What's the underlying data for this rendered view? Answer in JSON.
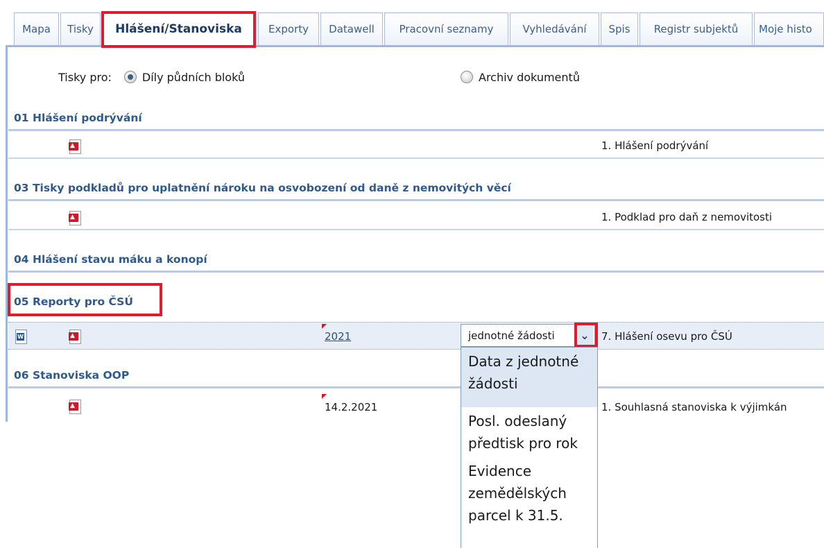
{
  "tabs": [
    {
      "label": "Mapa"
    },
    {
      "label": "Tisky"
    },
    {
      "label": "Hlášení/Stanoviska"
    },
    {
      "label": "Exporty"
    },
    {
      "label": "Datawell"
    },
    {
      "label": "Pracovní seznamy"
    },
    {
      "label": "Vyhledávání"
    },
    {
      "label": "Spis"
    },
    {
      "label": "Registr subjektů"
    },
    {
      "label": "Moje histo"
    }
  ],
  "print_for": {
    "label": "Tisky pro:",
    "options": [
      {
        "label": "Díly půdních bloků",
        "selected": true
      },
      {
        "label": "Archiv dokumentů",
        "selected": false
      }
    ]
  },
  "sections": [
    {
      "title": "01 Hlášení podrývání",
      "rows": [
        {
          "name": "1. Hlášení podrývání",
          "icons": [
            "pdf-icon"
          ]
        }
      ]
    },
    {
      "title": "03 Tisky podkladů pro uplatnění nároku na osvobození od daně z nemovitých věcí",
      "rows": [
        {
          "name": "1. Podklad pro daň z nemovitosti",
          "icons": [
            "pdf-icon"
          ]
        }
      ]
    },
    {
      "title": "04 Hlášení stavu máku a konopí",
      "rows": []
    },
    {
      "title": "05 Reporty pro ČSÚ",
      "rows": [
        {
          "name": "7. Hlášení osevu pro ČSÚ",
          "icons": [
            "word-icon",
            "pdf-icon"
          ],
          "date": "2021",
          "source_select": "jednotné žádosti"
        }
      ]
    },
    {
      "title": "06 Stanoviska OOP",
      "rows": [
        {
          "name": "1. Souhlasná stanoviska k výjimkán",
          "icons": [
            "pdf-icon"
          ],
          "date": "14.2.2021"
        }
      ]
    }
  ],
  "dropdown": {
    "options": [
      {
        "label": "Data z jednotné žádosti",
        "selected": true
      },
      {
        "label": "Posl. odeslaný předtisk pro rok",
        "selected": false
      },
      {
        "label": "Evidence zemědělských parcel k 31.5.",
        "selected": false
      }
    ]
  },
  "colors": {
    "accent": "#2e5a8c",
    "highlight": "#e01b2e",
    "pdf": "#d0182b"
  }
}
